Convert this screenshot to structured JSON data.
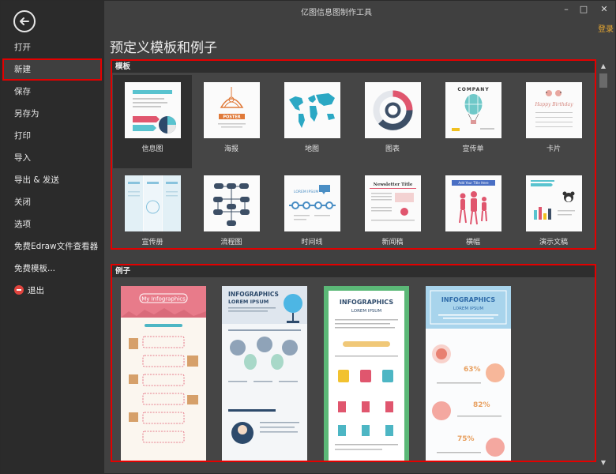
{
  "window": {
    "title": "亿图信息图制作工具",
    "controls": [
      "–",
      "□",
      "✕"
    ],
    "login": "登录"
  },
  "sidebar": {
    "items": [
      {
        "label": "打开"
      },
      {
        "label": "新建"
      },
      {
        "label": "保存"
      },
      {
        "label": "另存为"
      },
      {
        "label": "打印"
      },
      {
        "label": "导入"
      },
      {
        "label": "导出 & 发送"
      },
      {
        "label": "关闭"
      },
      {
        "label": "选项"
      },
      {
        "label": "免费Edraw文件查看器"
      },
      {
        "label": "免费模板..."
      },
      {
        "label": "退出"
      }
    ],
    "active_index": 1
  },
  "page": {
    "title": "预定义模板和例子"
  },
  "templates": {
    "header": "模板",
    "items": [
      {
        "label": "信息图",
        "icon": "infographic-thumb"
      },
      {
        "label": "海报",
        "icon": "poster-thumb"
      },
      {
        "label": "地图",
        "icon": "map-thumb"
      },
      {
        "label": "图表",
        "icon": "chart-thumb"
      },
      {
        "label": "宣传单",
        "icon": "flyer-thumb"
      },
      {
        "label": "卡片",
        "icon": "card-thumb"
      },
      {
        "label": "宣传册",
        "icon": "brochure-thumb"
      },
      {
        "label": "流程图",
        "icon": "flowchart-thumb"
      },
      {
        "label": "时间线",
        "icon": "timeline-thumb"
      },
      {
        "label": "新闻稿",
        "icon": "newsletter-thumb"
      },
      {
        "label": "横幅",
        "icon": "banner-thumb"
      },
      {
        "label": "演示文稿",
        "icon": "presentation-thumb"
      }
    ],
    "thumb_text": {
      "poster": "POSTER",
      "flyer": "COMPANY",
      "card": "Happy Birthday",
      "timeline": "LOREM IPSUM",
      "newsletter": "Newsletter Title",
      "banner": "Add Your Title Here"
    }
  },
  "examples": {
    "header": "例子",
    "items": [
      {
        "title": "My Infographics",
        "subtitle": ""
      },
      {
        "title": "INFOGRAPHICS",
        "subtitle": "LOREM IPSUM"
      },
      {
        "title": "INFOGRAPHICS",
        "subtitle": "LOREM IPSUM"
      },
      {
        "title": "INFOGRAPHICS",
        "subtitle": "LOREM IPSUM"
      }
    ],
    "stats": [
      "63%",
      "82%",
      "75%"
    ]
  },
  "colors": {
    "highlight": "#e30000",
    "sidebar_bg": "#2b2b2b",
    "content_bg": "#404040",
    "login": "#e8a830"
  }
}
